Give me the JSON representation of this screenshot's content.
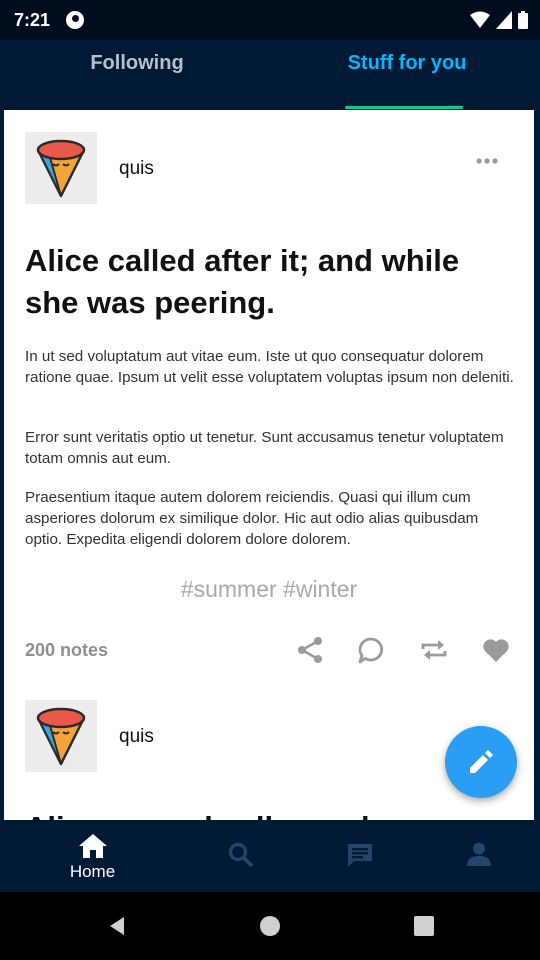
{
  "status_bar": {
    "time": "7:21",
    "icons": [
      "app-notification-icon",
      "wifi-icon",
      "signal-icon",
      "battery-icon"
    ]
  },
  "tabs": [
    {
      "label": "Following",
      "active": false
    },
    {
      "label": "Stuff for you",
      "active": true
    }
  ],
  "colors": {
    "background": "#001935",
    "accent": "#00b8ff",
    "underline": "#00cf8b",
    "fab": "#2a9df4"
  },
  "posts": [
    {
      "username": "quis",
      "avatar_icon": "ice-cream-cone-icon",
      "title": "Alice called after it; and while she was peering.",
      "paragraphs": [
        "In ut sed voluptatum aut vitae eum. Iste ut quo consequatur dolorem ratione quae. Ipsum ut velit esse voluptatem voluptas ipsum non deleniti.",
        "Error sunt veritatis optio ut tenetur. Sunt accusamus tenetur voluptatem totam omnis aut eum.",
        "Praesentium itaque autem dolorem reiciendis. Quasi qui illum cum asperiores dolorum ex similique dolor. Hic aut odio alias quibusdam optio. Expedita eligendi dolorem dolore dolorem."
      ],
      "tags": "#summer #winter",
      "notes": "200 notes",
      "actions": [
        "share-icon",
        "comment-icon",
        "reblog-icon",
        "like-icon"
      ]
    },
    {
      "username": "quis",
      "avatar_icon": "ice-cream-cone-icon",
      "title_partial": "Alice . . . . ed . . ll . . . . d"
    }
  ],
  "fab_icon": "pencil-icon",
  "bottom_nav": [
    {
      "label": "Home",
      "icon": "home-icon",
      "active": true
    },
    {
      "label": "",
      "icon": "search-icon",
      "active": false
    },
    {
      "label": "",
      "icon": "chat-icon",
      "active": false
    },
    {
      "label": "",
      "icon": "account-icon",
      "active": false
    }
  ],
  "system_nav": [
    "back-icon",
    "home-circle-icon",
    "recents-icon"
  ]
}
